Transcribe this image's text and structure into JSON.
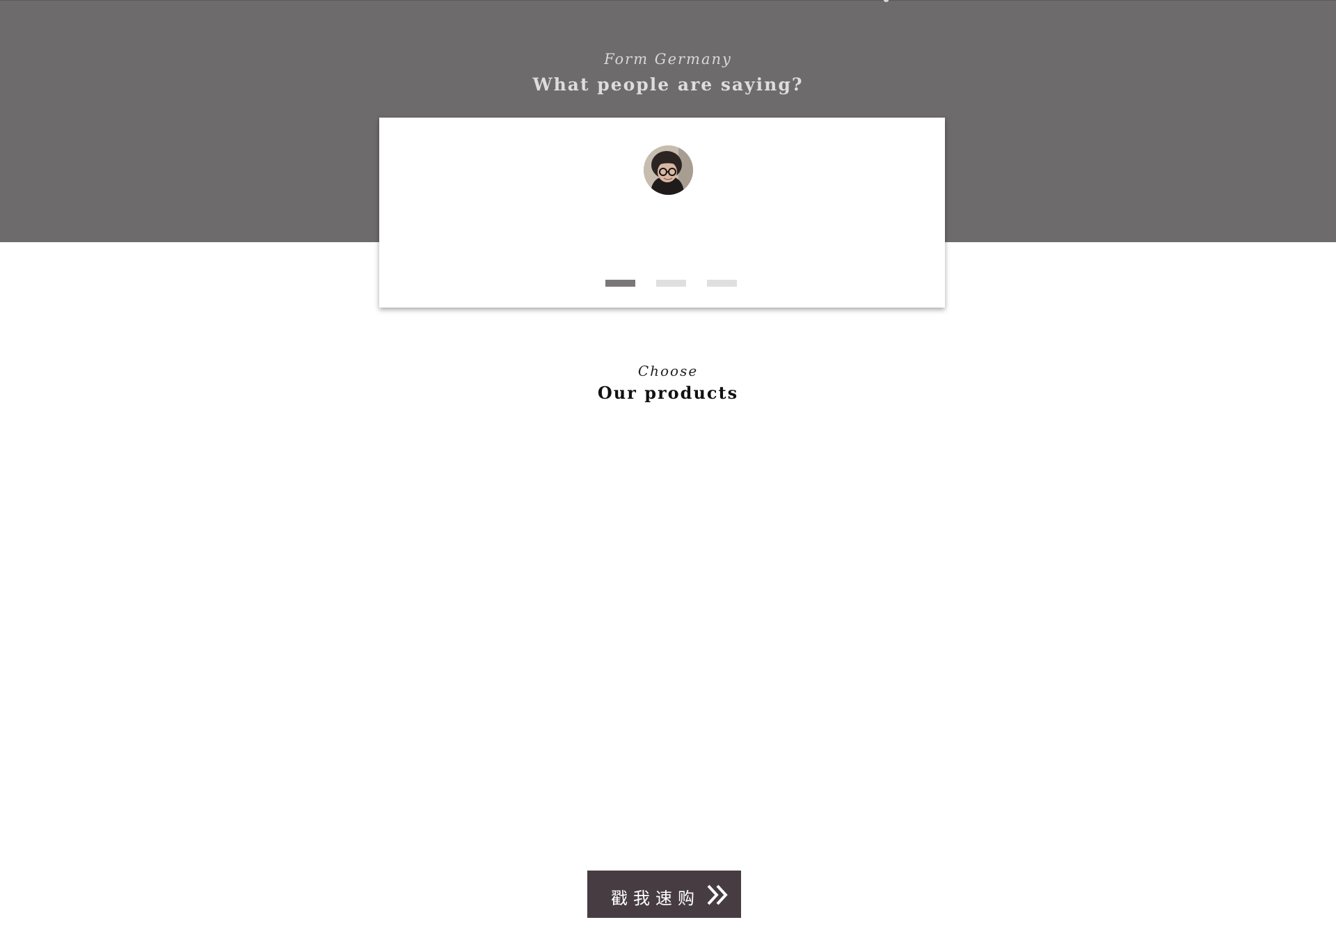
{
  "testimonials": {
    "kicker": "Form Germany",
    "heading": "What people are saying?",
    "slides": [
      {
        "label": "Slide 1",
        "active": true
      },
      {
        "label": "Slide 2",
        "active": false
      },
      {
        "label": "Slide 3",
        "active": false
      }
    ]
  },
  "products": {
    "kicker": "Choose",
    "heading": "Our products"
  },
  "cta": {
    "label": "戳我速购",
    "icon": "double-chevron-right-icon"
  },
  "colors": {
    "band": "#6d6b6c",
    "button": "#473c42",
    "dot_active": "#7b7779",
    "dot_inactive": "#e0dfdf"
  }
}
